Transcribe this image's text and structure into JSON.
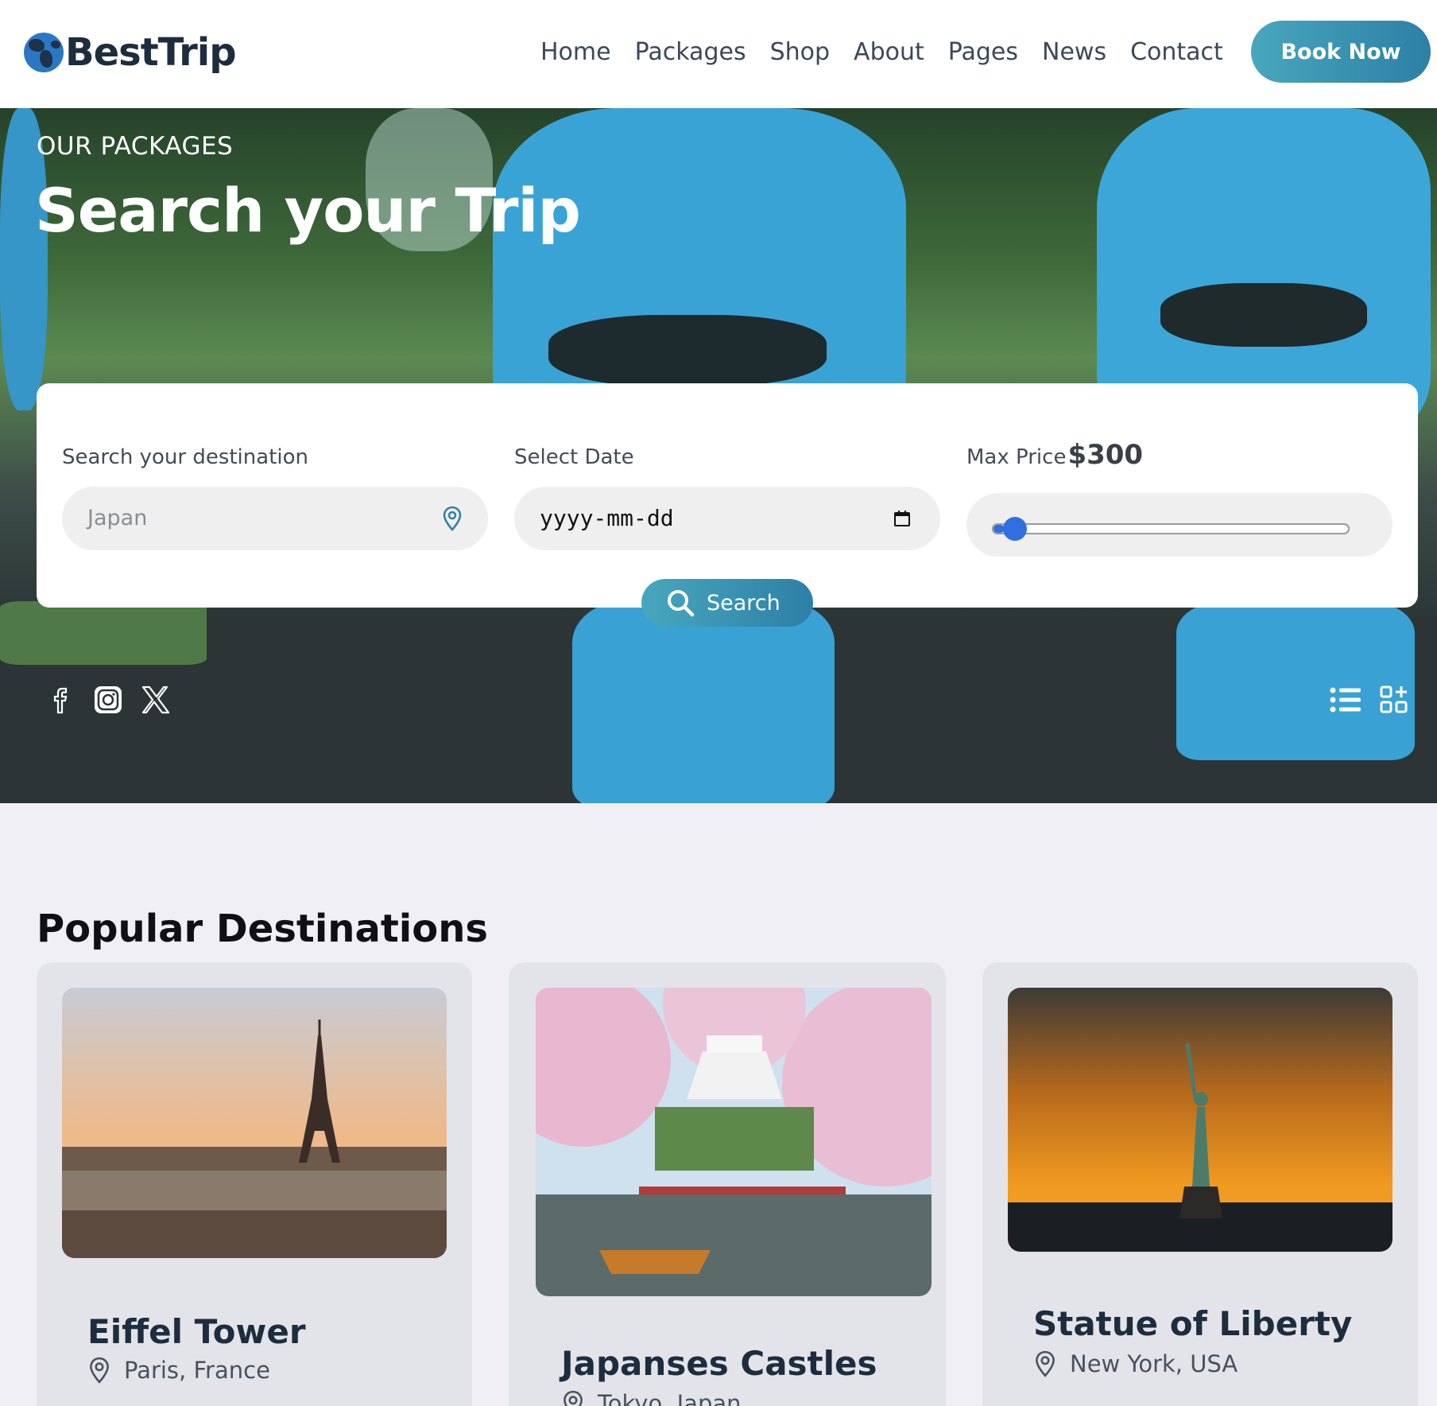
{
  "header": {
    "logo_text": "BestTrip",
    "nav": [
      "Home",
      "Packages",
      "Shop",
      "About",
      "Pages",
      "News",
      "Contact"
    ],
    "book_label": "Book Now"
  },
  "hero": {
    "subtitle": "OUR PACKAGES",
    "title": "Search your Trip",
    "search": {
      "destination_label": "Search your destination",
      "destination_value": "Japan",
      "date_label": "Select Date",
      "date_placeholder": "yyyy-mm-dd",
      "price_label": "Max Price",
      "price_value": "$300",
      "price_slider_fraction": 0.03,
      "search_label": "Search"
    },
    "social_icons": [
      "facebook-icon",
      "instagram-icon",
      "x-icon"
    ],
    "view_icons": [
      "list-view-icon",
      "grid-add-icon"
    ]
  },
  "popular": {
    "title": "Popular Destinations",
    "cards": [
      {
        "title": "Eiffel Tower",
        "location": "Paris, France"
      },
      {
        "title": "Japanses Castles",
        "location": "Tokyo, Japan"
      },
      {
        "title": "Statue of Liberty",
        "location": "New York, USA"
      }
    ]
  },
  "colors": {
    "accent": "#3a93b4",
    "slider": "#2f6fe0",
    "heading": "#1e2d3d",
    "page_bg": "#efeff4"
  }
}
